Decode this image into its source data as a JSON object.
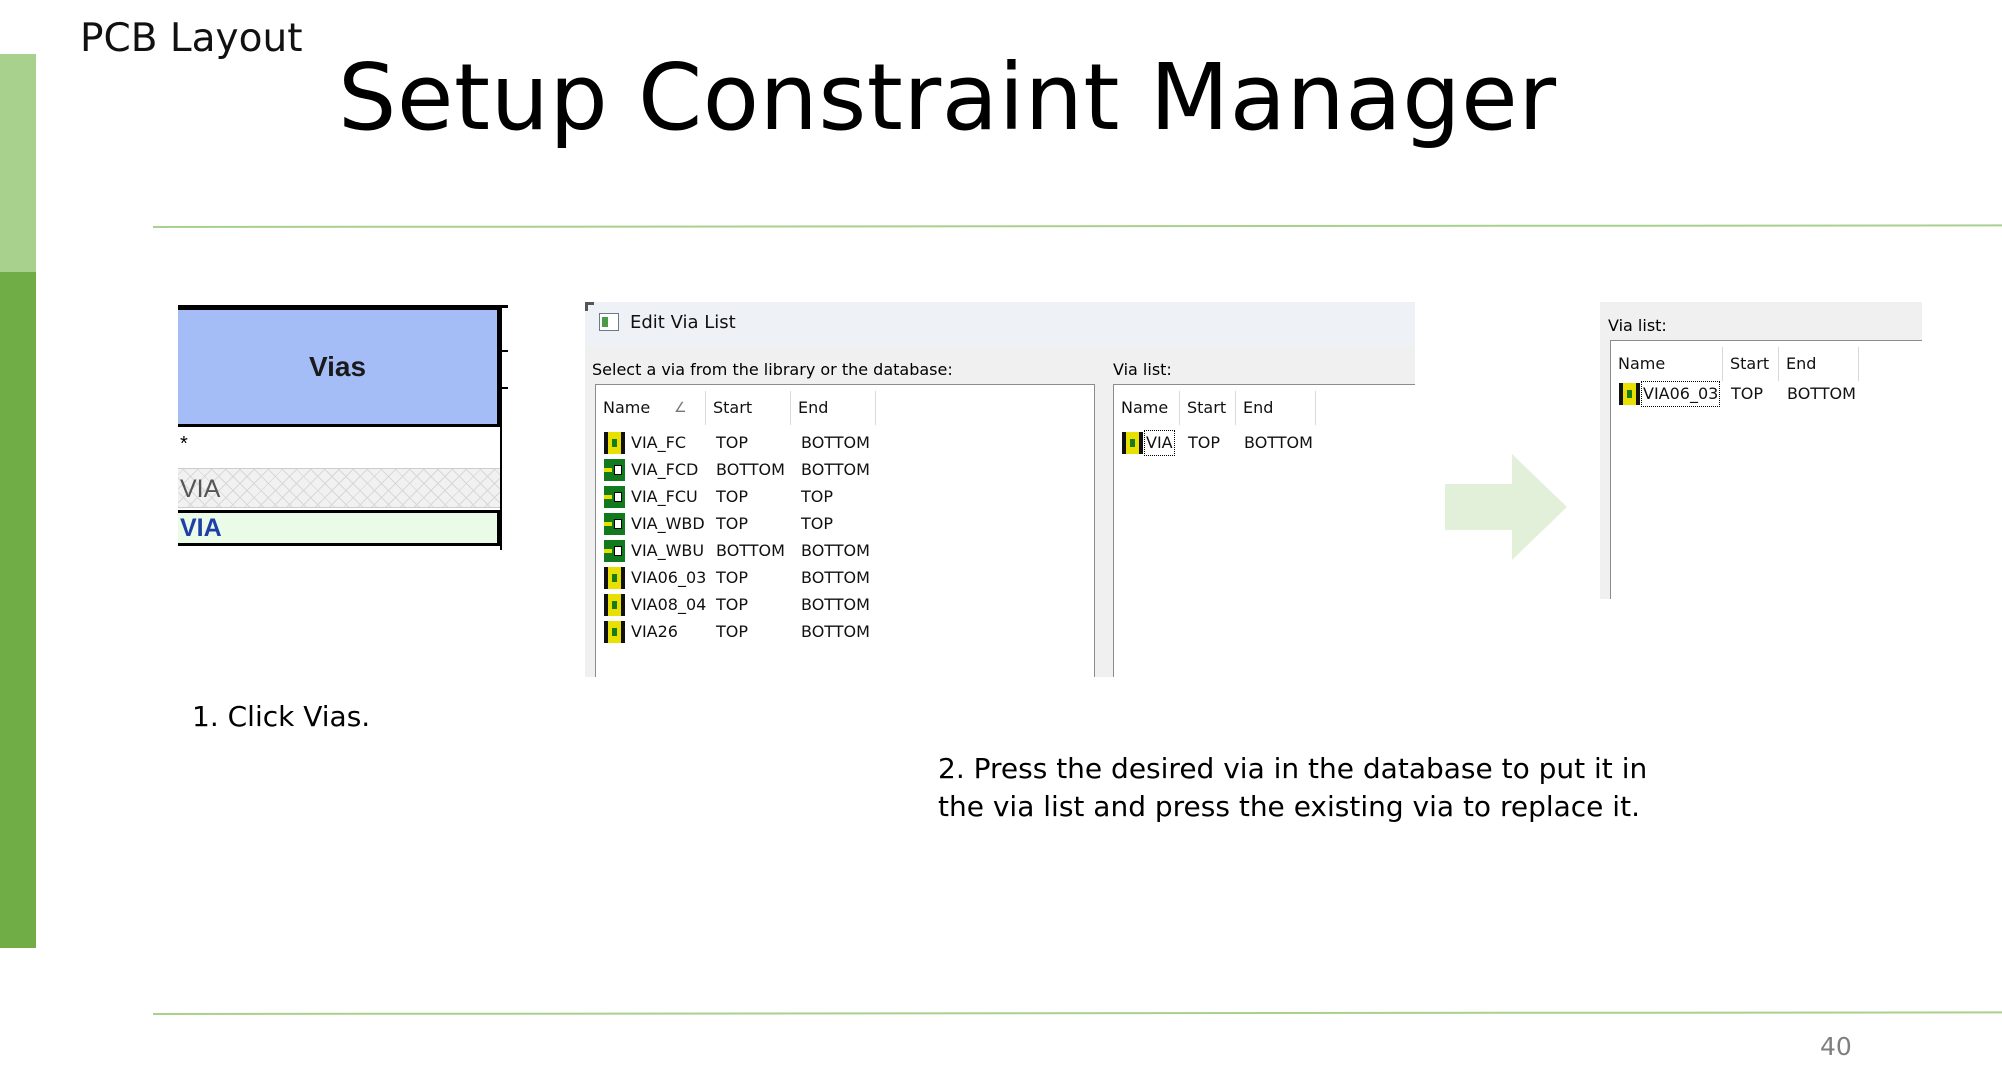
{
  "slide": {
    "section_label": "PCB Layout",
    "title": "Setup Constraint Manager",
    "page_number": "40",
    "colors": {
      "accent_light": "#a9d18e",
      "accent_dark": "#70ad47",
      "rule": "#a9d18e"
    }
  },
  "vias_panel": {
    "header": "Vias",
    "star": "*",
    "row_inactive": "VIA",
    "row_selected": "VIA",
    "colors": {
      "header_bg": "#a4bdf7",
      "selected_bg": "#eafbe8",
      "selected_text": "#1f3ea8"
    }
  },
  "edit_via_dialog": {
    "title": "Edit Via List",
    "library_prompt": "Select a via from the library or the database:",
    "via_list_label": "Via list:",
    "columns": {
      "name": "Name",
      "start": "Start",
      "end": "End",
      "sort_icon": "sort-indicator-icon"
    },
    "library_rows": [
      {
        "icon": "via-yellow-icon",
        "name": "VIA_FC",
        "start": "TOP",
        "end": "BOTTOM"
      },
      {
        "icon": "via-green-icon",
        "name": "VIA_FCD",
        "start": "BOTTOM",
        "end": "BOTTOM"
      },
      {
        "icon": "via-green-icon",
        "name": "VIA_FCU",
        "start": "TOP",
        "end": "TOP"
      },
      {
        "icon": "via-green-icon",
        "name": "VIA_WBD",
        "start": "TOP",
        "end": "TOP"
      },
      {
        "icon": "via-green-icon",
        "name": "VIA_WBU",
        "start": "BOTTOM",
        "end": "BOTTOM"
      },
      {
        "icon": "via-yellow-icon",
        "name": "VIA06_03",
        "start": "TOP",
        "end": "BOTTOM"
      },
      {
        "icon": "via-yellow-icon",
        "name": "VIA08_04",
        "start": "TOP",
        "end": "BOTTOM"
      },
      {
        "icon": "via-yellow-icon",
        "name": "VIA26",
        "start": "TOP",
        "end": "BOTTOM"
      }
    ],
    "via_list_rows": [
      {
        "icon": "via-yellow-icon",
        "name": "VIA",
        "start": "TOP",
        "end": "BOTTOM"
      }
    ]
  },
  "arrow": {
    "icon": "right-arrow-icon",
    "color": "#e2f0d9"
  },
  "result_panel": {
    "label": "Via list:",
    "columns": {
      "name": "Name",
      "start": "Start",
      "end": "End"
    },
    "rows": [
      {
        "icon": "via-yellow-icon",
        "name": "VIA06_03",
        "start": "TOP",
        "end": "BOTTOM"
      }
    ]
  },
  "captions": {
    "step1": "1. Click Vias.",
    "step2_line1": "2. Press the desired via in the database to put it in",
    "step2_line2": "the via list and press the existing via to replace it."
  }
}
